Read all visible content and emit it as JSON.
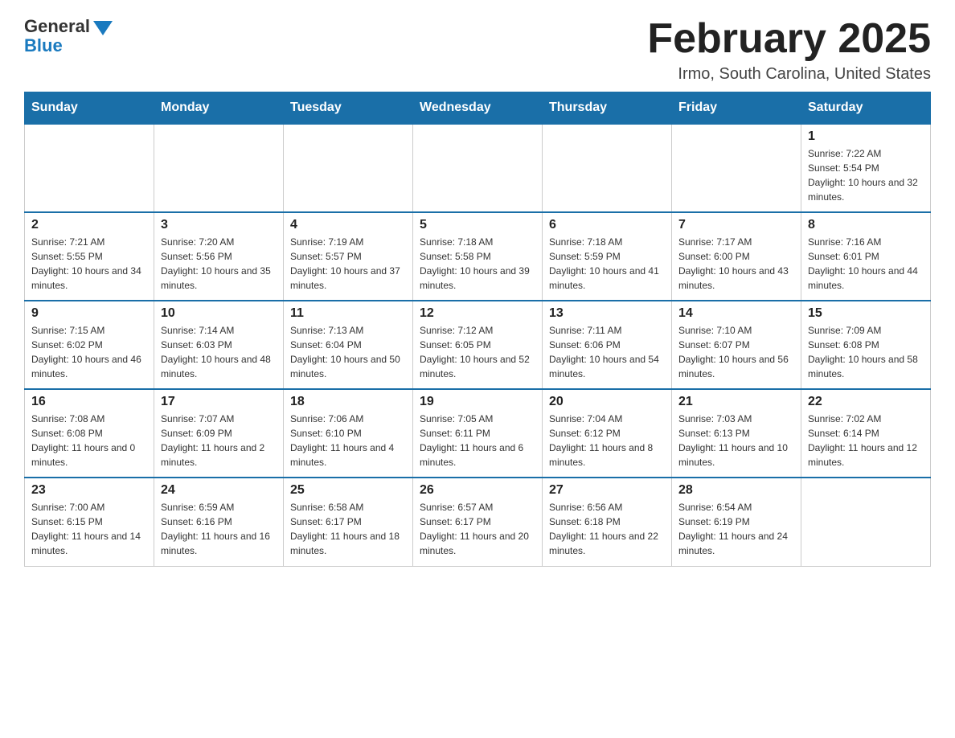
{
  "logo": {
    "general": "General",
    "blue": "Blue"
  },
  "title": "February 2025",
  "location": "Irmo, South Carolina, United States",
  "days_of_week": [
    "Sunday",
    "Monday",
    "Tuesday",
    "Wednesday",
    "Thursday",
    "Friday",
    "Saturday"
  ],
  "weeks": [
    [
      {
        "day": "",
        "sunrise": "",
        "sunset": "",
        "daylight": ""
      },
      {
        "day": "",
        "sunrise": "",
        "sunset": "",
        "daylight": ""
      },
      {
        "day": "",
        "sunrise": "",
        "sunset": "",
        "daylight": ""
      },
      {
        "day": "",
        "sunrise": "",
        "sunset": "",
        "daylight": ""
      },
      {
        "day": "",
        "sunrise": "",
        "sunset": "",
        "daylight": ""
      },
      {
        "day": "",
        "sunrise": "",
        "sunset": "",
        "daylight": ""
      },
      {
        "day": "1",
        "sunrise": "Sunrise: 7:22 AM",
        "sunset": "Sunset: 5:54 PM",
        "daylight": "Daylight: 10 hours and 32 minutes."
      }
    ],
    [
      {
        "day": "2",
        "sunrise": "Sunrise: 7:21 AM",
        "sunset": "Sunset: 5:55 PM",
        "daylight": "Daylight: 10 hours and 34 minutes."
      },
      {
        "day": "3",
        "sunrise": "Sunrise: 7:20 AM",
        "sunset": "Sunset: 5:56 PM",
        "daylight": "Daylight: 10 hours and 35 minutes."
      },
      {
        "day": "4",
        "sunrise": "Sunrise: 7:19 AM",
        "sunset": "Sunset: 5:57 PM",
        "daylight": "Daylight: 10 hours and 37 minutes."
      },
      {
        "day": "5",
        "sunrise": "Sunrise: 7:18 AM",
        "sunset": "Sunset: 5:58 PM",
        "daylight": "Daylight: 10 hours and 39 minutes."
      },
      {
        "day": "6",
        "sunrise": "Sunrise: 7:18 AM",
        "sunset": "Sunset: 5:59 PM",
        "daylight": "Daylight: 10 hours and 41 minutes."
      },
      {
        "day": "7",
        "sunrise": "Sunrise: 7:17 AM",
        "sunset": "Sunset: 6:00 PM",
        "daylight": "Daylight: 10 hours and 43 minutes."
      },
      {
        "day": "8",
        "sunrise": "Sunrise: 7:16 AM",
        "sunset": "Sunset: 6:01 PM",
        "daylight": "Daylight: 10 hours and 44 minutes."
      }
    ],
    [
      {
        "day": "9",
        "sunrise": "Sunrise: 7:15 AM",
        "sunset": "Sunset: 6:02 PM",
        "daylight": "Daylight: 10 hours and 46 minutes."
      },
      {
        "day": "10",
        "sunrise": "Sunrise: 7:14 AM",
        "sunset": "Sunset: 6:03 PM",
        "daylight": "Daylight: 10 hours and 48 minutes."
      },
      {
        "day": "11",
        "sunrise": "Sunrise: 7:13 AM",
        "sunset": "Sunset: 6:04 PM",
        "daylight": "Daylight: 10 hours and 50 minutes."
      },
      {
        "day": "12",
        "sunrise": "Sunrise: 7:12 AM",
        "sunset": "Sunset: 6:05 PM",
        "daylight": "Daylight: 10 hours and 52 minutes."
      },
      {
        "day": "13",
        "sunrise": "Sunrise: 7:11 AM",
        "sunset": "Sunset: 6:06 PM",
        "daylight": "Daylight: 10 hours and 54 minutes."
      },
      {
        "day": "14",
        "sunrise": "Sunrise: 7:10 AM",
        "sunset": "Sunset: 6:07 PM",
        "daylight": "Daylight: 10 hours and 56 minutes."
      },
      {
        "day": "15",
        "sunrise": "Sunrise: 7:09 AM",
        "sunset": "Sunset: 6:08 PM",
        "daylight": "Daylight: 10 hours and 58 minutes."
      }
    ],
    [
      {
        "day": "16",
        "sunrise": "Sunrise: 7:08 AM",
        "sunset": "Sunset: 6:08 PM",
        "daylight": "Daylight: 11 hours and 0 minutes."
      },
      {
        "day": "17",
        "sunrise": "Sunrise: 7:07 AM",
        "sunset": "Sunset: 6:09 PM",
        "daylight": "Daylight: 11 hours and 2 minutes."
      },
      {
        "day": "18",
        "sunrise": "Sunrise: 7:06 AM",
        "sunset": "Sunset: 6:10 PM",
        "daylight": "Daylight: 11 hours and 4 minutes."
      },
      {
        "day": "19",
        "sunrise": "Sunrise: 7:05 AM",
        "sunset": "Sunset: 6:11 PM",
        "daylight": "Daylight: 11 hours and 6 minutes."
      },
      {
        "day": "20",
        "sunrise": "Sunrise: 7:04 AM",
        "sunset": "Sunset: 6:12 PM",
        "daylight": "Daylight: 11 hours and 8 minutes."
      },
      {
        "day": "21",
        "sunrise": "Sunrise: 7:03 AM",
        "sunset": "Sunset: 6:13 PM",
        "daylight": "Daylight: 11 hours and 10 minutes."
      },
      {
        "day": "22",
        "sunrise": "Sunrise: 7:02 AM",
        "sunset": "Sunset: 6:14 PM",
        "daylight": "Daylight: 11 hours and 12 minutes."
      }
    ],
    [
      {
        "day": "23",
        "sunrise": "Sunrise: 7:00 AM",
        "sunset": "Sunset: 6:15 PM",
        "daylight": "Daylight: 11 hours and 14 minutes."
      },
      {
        "day": "24",
        "sunrise": "Sunrise: 6:59 AM",
        "sunset": "Sunset: 6:16 PM",
        "daylight": "Daylight: 11 hours and 16 minutes."
      },
      {
        "day": "25",
        "sunrise": "Sunrise: 6:58 AM",
        "sunset": "Sunset: 6:17 PM",
        "daylight": "Daylight: 11 hours and 18 minutes."
      },
      {
        "day": "26",
        "sunrise": "Sunrise: 6:57 AM",
        "sunset": "Sunset: 6:17 PM",
        "daylight": "Daylight: 11 hours and 20 minutes."
      },
      {
        "day": "27",
        "sunrise": "Sunrise: 6:56 AM",
        "sunset": "Sunset: 6:18 PM",
        "daylight": "Daylight: 11 hours and 22 minutes."
      },
      {
        "day": "28",
        "sunrise": "Sunrise: 6:54 AM",
        "sunset": "Sunset: 6:19 PM",
        "daylight": "Daylight: 11 hours and 24 minutes."
      },
      {
        "day": "",
        "sunrise": "",
        "sunset": "",
        "daylight": ""
      }
    ]
  ]
}
